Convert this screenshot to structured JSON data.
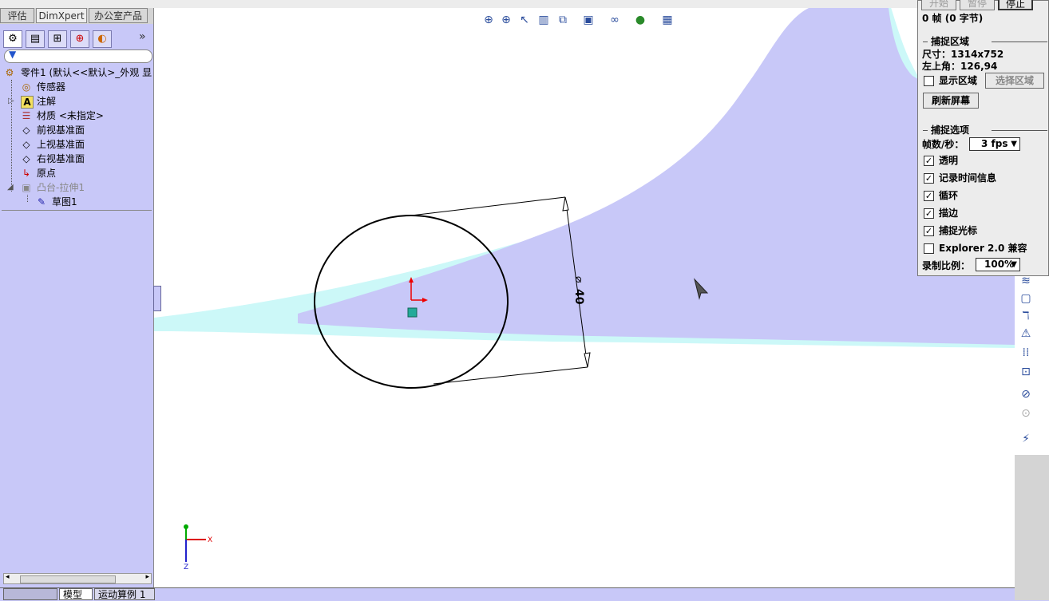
{
  "top_tabs": [
    "评估",
    "DimXpert",
    "办公室产品"
  ],
  "manager_tabs": [
    {
      "name": "featuremanager",
      "glyph": "⚙"
    },
    {
      "name": "propertymanager",
      "glyph": "▤"
    },
    {
      "name": "configurationmanager",
      "glyph": "⊞"
    },
    {
      "name": "dimxpertmanager",
      "glyph": "⊕"
    },
    {
      "name": "displaymanager",
      "glyph": "◐"
    }
  ],
  "manager_more": "»",
  "tree": [
    {
      "label": "零件1  (默认<<默认>_外观 显",
      "icon": "⚙",
      "indent": 0
    },
    {
      "label": "传感器",
      "icon": "◎",
      "indent": 1
    },
    {
      "label": "注解",
      "icon": "A",
      "indent": 1
    },
    {
      "label": "材质 <未指定>",
      "icon": "☰",
      "indent": 1
    },
    {
      "label": "前视基准面",
      "icon": "◇",
      "indent": 1
    },
    {
      "label": "上视基准面",
      "icon": "◇",
      "indent": 1
    },
    {
      "label": "右视基准面",
      "icon": "◇",
      "indent": 1
    },
    {
      "label": "原点",
      "icon": "↳",
      "indent": 1
    },
    {
      "label": "凸台-拉伸1",
      "icon": "▣",
      "indent": 1,
      "dimmed": true
    },
    {
      "label": "草图1",
      "icon": "✎",
      "indent": 2
    }
  ],
  "bottom_tabs": [
    "模型",
    "运动算例 1"
  ],
  "view_toolbar": [
    {
      "name": "zoom-to-fit-icon",
      "glyph": "⊕"
    },
    {
      "name": "zoom-to-area-icon",
      "glyph": "⊕"
    },
    {
      "name": "previous-view-icon",
      "glyph": "↖"
    },
    {
      "name": "section-view-icon",
      "glyph": "▥"
    },
    {
      "name": "view-orientation-icon",
      "glyph": "⧉"
    },
    {
      "name": "display-style-icon",
      "glyph": "▣"
    },
    {
      "name": "hide-show-items-icon",
      "glyph": "∞"
    },
    {
      "name": "edit-appearance-icon",
      "glyph": "●"
    },
    {
      "name": "apply-scene-icon",
      "glyph": "▦"
    }
  ],
  "right_toolbar": [
    "≋",
    "▢",
    "ℸ",
    "⚠",
    "⁞⁞",
    "⊡",
    "⊘",
    "⊙",
    "⚡"
  ],
  "sketch": {
    "dimension_text": "40",
    "dimension_symbol": "⌀"
  },
  "recorder": {
    "buttons": [
      "开始",
      "暂停",
      "停止"
    ],
    "frame_info": "0 帧 (0 字节)",
    "capture_area_title": "捕捉区域",
    "size_label": "尺寸：",
    "size_value": "1314x752",
    "topleft_label": "左上角：",
    "topleft_value": "126,94",
    "show_area_label": "显示区域",
    "select_area_button": "选择区域",
    "refresh_button": "刷新屏幕",
    "capture_options_title": "捕捉选项",
    "fps_label": "帧数/秒：",
    "fps_value": "3 fps",
    "options": [
      {
        "label": "透明",
        "checked": true
      },
      {
        "label": "记录时间信息",
        "checked": true
      },
      {
        "label": "循环",
        "checked": true
      },
      {
        "label": "描边",
        "checked": true
      },
      {
        "label": "捕捉光标",
        "checked": true
      },
      {
        "label": "Explorer 2.0 兼容",
        "checked": false
      }
    ],
    "scale_label": "录制比例：",
    "scale_value": "100%"
  }
}
